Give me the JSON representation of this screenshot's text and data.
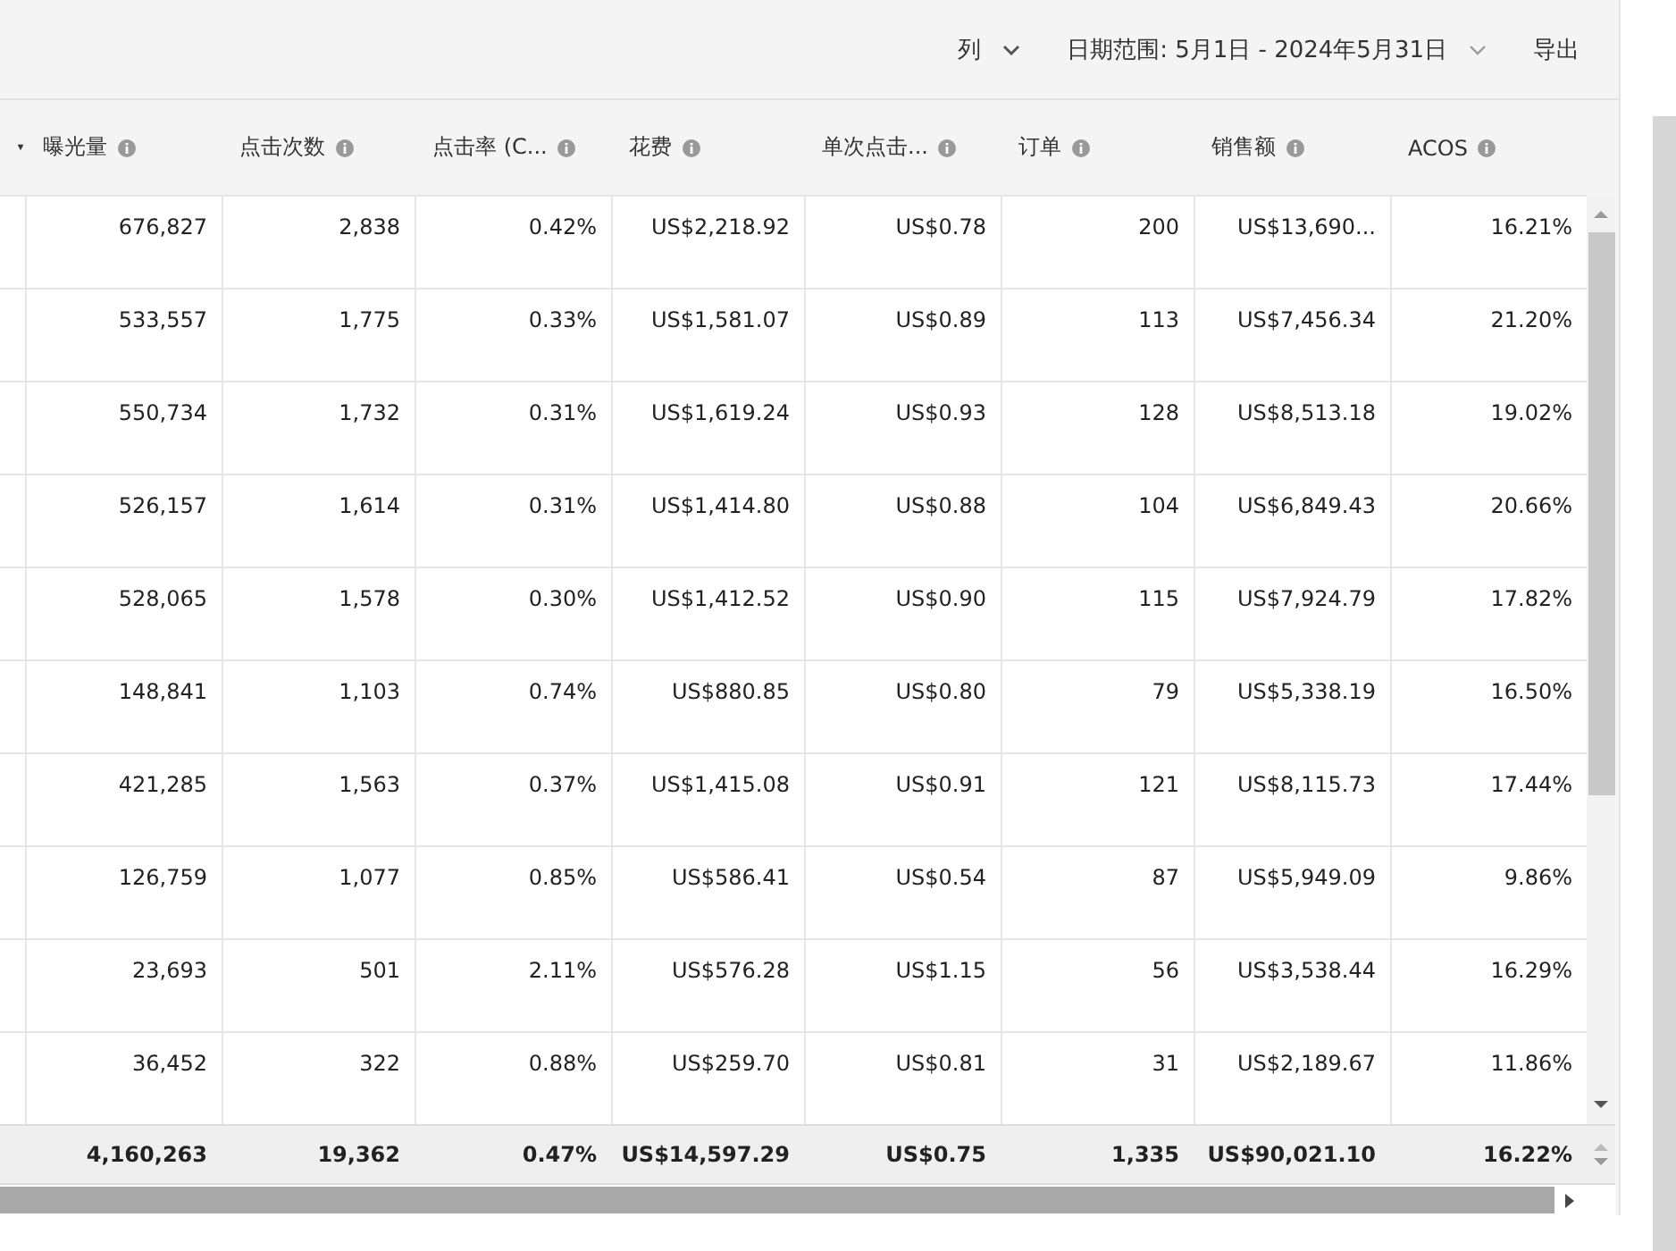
{
  "toolbar": {
    "columns_button": "列",
    "date_range": "日期范围: 5月1日 - 2024年5月31日",
    "export_button": "导出"
  },
  "table": {
    "columns": [
      "曝光量",
      "点击次数",
      "点击率 (C...",
      "花费",
      "单次点击...",
      "订单",
      "销售额",
      "ACOS"
    ],
    "rows": [
      [
        "676,827",
        "2,838",
        "0.42%",
        "US$2,218.92",
        "US$0.78",
        "200",
        "US$13,690...",
        "16.21%"
      ],
      [
        "533,557",
        "1,775",
        "0.33%",
        "US$1,581.07",
        "US$0.89",
        "113",
        "US$7,456.34",
        "21.20%"
      ],
      [
        "550,734",
        "1,732",
        "0.31%",
        "US$1,619.24",
        "US$0.93",
        "128",
        "US$8,513.18",
        "19.02%"
      ],
      [
        "526,157",
        "1,614",
        "0.31%",
        "US$1,414.80",
        "US$0.88",
        "104",
        "US$6,849.43",
        "20.66%"
      ],
      [
        "528,065",
        "1,578",
        "0.30%",
        "US$1,412.52",
        "US$0.90",
        "115",
        "US$7,924.79",
        "17.82%"
      ],
      [
        "148,841",
        "1,103",
        "0.74%",
        "US$880.85",
        "US$0.80",
        "79",
        "US$5,338.19",
        "16.50%"
      ],
      [
        "421,285",
        "1,563",
        "0.37%",
        "US$1,415.08",
        "US$0.91",
        "121",
        "US$8,115.73",
        "17.44%"
      ],
      [
        "126,759",
        "1,077",
        "0.85%",
        "US$586.41",
        "US$0.54",
        "87",
        "US$5,949.09",
        "9.86%"
      ],
      [
        "23,693",
        "501",
        "2.11%",
        "US$576.28",
        "US$1.15",
        "56",
        "US$3,538.44",
        "16.29%"
      ],
      [
        "36,452",
        "322",
        "0.88%",
        "US$259.70",
        "US$0.81",
        "31",
        "US$2,189.67",
        "11.86%"
      ]
    ],
    "totals": [
      "4,160,263",
      "19,362",
      "0.47%",
      "US$14,597.29",
      "US$0.75",
      "1,335",
      "US$90,021.10",
      "16.22%"
    ]
  }
}
